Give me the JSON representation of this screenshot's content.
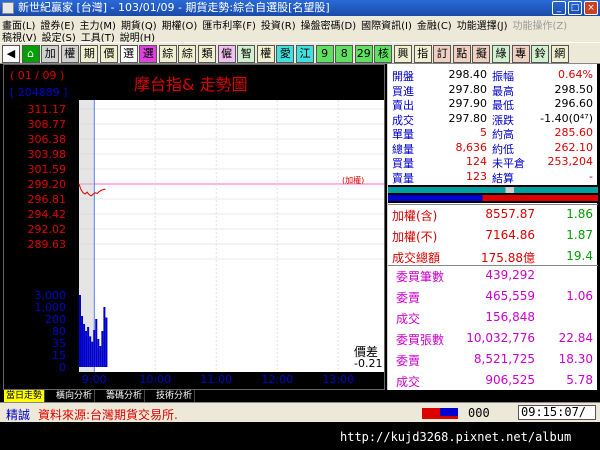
{
  "window": {
    "title": "新世紀贏家 [台灣] - 103/01/09 - 期貨走勢:綜合自選股[名望股]",
    "min_label": "_",
    "max_label": "□",
    "close_label": "×"
  },
  "menu": {
    "row1": [
      {
        "label": "畫面(L)",
        "enabled": true
      },
      {
        "label": "證券(E)",
        "enabled": true
      },
      {
        "label": "主力(M)",
        "enabled": true
      },
      {
        "label": "期貨(Q)",
        "enabled": true
      },
      {
        "label": "期權(O)",
        "enabled": true
      },
      {
        "label": "匯市利率(F)",
        "enabled": true
      },
      {
        "label": "投資(R)",
        "enabled": true
      },
      {
        "label": "操盤密碼(D)",
        "enabled": true
      },
      {
        "label": "國際資訊(I)",
        "enabled": true
      },
      {
        "label": "金融(C)",
        "enabled": true
      },
      {
        "label": "功能選擇(J)",
        "enabled": true
      },
      {
        "label": "功能操作(Z)",
        "enabled": false
      }
    ],
    "row2": [
      {
        "label": "稿視(V)",
        "enabled": true
      },
      {
        "label": "設定(S)",
        "enabled": true
      },
      {
        "label": "工具(T)",
        "enabled": true
      },
      {
        "label": "說明(H)",
        "enabled": true
      }
    ]
  },
  "toolbar": {
    "buttons": [
      {
        "label": "◀",
        "bg": "#ffffff",
        "fg": "#000000"
      },
      {
        "label": "⌂",
        "bg": "#00a000",
        "fg": "#ffffff"
      },
      {
        "label": "加",
        "bg": "#d0d0d0",
        "fg": "#000000"
      },
      {
        "label": "權",
        "bg": "#d0d0d0",
        "fg": "#000000"
      },
      {
        "label": "期",
        "bg": "#f0f0d0",
        "fg": "#000000"
      },
      {
        "label": "價",
        "bg": "#f0f0d0",
        "fg": "#000000"
      },
      {
        "label": "選",
        "bg": "#ffffff",
        "fg": "#000000"
      },
      {
        "label": "選",
        "bg": "#e040e0",
        "fg": "#000000"
      },
      {
        "label": "綜",
        "bg": "#f0f0d0",
        "fg": "#000000"
      },
      {
        "label": "綜",
        "bg": "#f0f0d0",
        "fg": "#000000"
      },
      {
        "label": "類",
        "bg": "#f0f0d0",
        "fg": "#000000"
      },
      {
        "label": "僱",
        "bg": "#f0c0f0",
        "fg": "#000000"
      },
      {
        "label": "智",
        "bg": "#d0f0d0",
        "fg": "#000000"
      },
      {
        "label": "權",
        "bg": "#f0f0d0",
        "fg": "#000000"
      },
      {
        "label": "愛",
        "bg": "#40e0e0",
        "fg": "#000000"
      },
      {
        "label": "江",
        "bg": "#40e0e0",
        "fg": "#000000"
      },
      {
        "label": "9",
        "bg": "#60e060",
        "fg": "#000000"
      },
      {
        "label": "8",
        "bg": "#60e060",
        "fg": "#000000"
      },
      {
        "label": "29",
        "bg": "#60e060",
        "fg": "#000000"
      },
      {
        "label": "核",
        "bg": "#60e060",
        "fg": "#000000"
      },
      {
        "label": "興",
        "bg": "#f0f0d0",
        "fg": "#000000"
      },
      {
        "label": "指",
        "bg": "#f0f0d0",
        "fg": "#000000"
      },
      {
        "label": "訂",
        "bg": "#f0d0c0",
        "fg": "#000000"
      },
      {
        "label": "點",
        "bg": "#f0d0c0",
        "fg": "#000000"
      },
      {
        "label": "擬",
        "bg": "#f0d0c0",
        "fg": "#000000"
      },
      {
        "label": "綠",
        "bg": "#d0f0d0",
        "fg": "#000000"
      },
      {
        "label": "專",
        "bg": "#f0d0c0",
        "fg": "#000000"
      },
      {
        "label": "鈴",
        "bg": "#d0f0d0",
        "fg": "#000000"
      },
      {
        "label": "網",
        "bg": "#f0f0d0",
        "fg": "#000000"
      }
    ]
  },
  "chart": {
    "date": "( 01 / 09 )",
    "title": "摩台指&  走勢圖",
    "volume_box": "[ 204889 ]",
    "ref_label": "(加權)",
    "spread_label": "價差",
    "spread_value": "-0.21",
    "price_ticks": [
      "311.17",
      "308.77",
      "306.38",
      "303.98",
      "301.59",
      "299.20",
      "296.81",
      "294.42",
      "292.02",
      "289.63",
      "287.23"
    ],
    "ref_price_index": 5,
    "volume_ticks": [
      "3,000",
      "1,000",
      "200",
      "80",
      "35",
      "15",
      "0"
    ],
    "time_ticks": [
      "9:00",
      "10:00",
      "11:00",
      "12:00",
      "13:00"
    ]
  },
  "chart_data": {
    "type": "line",
    "title": "摩台指&  走勢圖",
    "x": [
      "08:45",
      "08:47",
      "08:49",
      "08:51",
      "08:53",
      "08:55",
      "08:57",
      "08:59",
      "09:01",
      "09:03",
      "09:05",
      "09:07",
      "09:09",
      "09:11"
    ],
    "series": [
      {
        "values": [
          299.2,
          298.3,
          297.8,
          297.6,
          297.9,
          297.5,
          297.3,
          297.6,
          297.8,
          297.7,
          298.0,
          298.2,
          298.3,
          298.4
        ]
      }
    ],
    "volume": [
      3000,
      400,
      150,
      80,
      120,
      60,
      40,
      90,
      200,
      50,
      30,
      80,
      1000,
      300
    ],
    "ylim": [
      287.23,
      311.17
    ],
    "xlim": [
      "08:45",
      "13:45"
    ]
  },
  "quote": {
    "rows": [
      {
        "l1": "開盤",
        "v1": "298.40",
        "l2": "振幅",
        "v2": "0.64%",
        "c1": "#000000",
        "c2": "#dd0000"
      },
      {
        "l1": "買進",
        "v1": "297.80",
        "l2": "最高",
        "v2": "298.50",
        "c1": "#000000",
        "c2": "#000000"
      },
      {
        "l1": "賣出",
        "v1": "297.90",
        "l2": "最低",
        "v2": "296.60",
        "c1": "#000000",
        "c2": "#000000"
      },
      {
        "l1": "成交",
        "v1": "297.80",
        "l2": "漲跌",
        "v2": "-1.40(0⁴⁷)",
        "c1": "#000000",
        "c2": "#000000"
      },
      {
        "l1": "單量",
        "v1": "5",
        "l2": "約高",
        "v2": "285.60",
        "c1": "#dd0000",
        "c2": "#dd0000"
      },
      {
        "l1": "總量",
        "v1": "8,636",
        "l2": "約低",
        "v2": "262.10",
        "c1": "#dd0000",
        "c2": "#dd0000"
      },
      {
        "l1": "買量",
        "v1": "124",
        "l2": "未平倉",
        "v2": "253,204",
        "c1": "#dd0000",
        "c2": "#dd0000"
      },
      {
        "l1": "賣量",
        "v1": "123",
        "l2": "結算",
        "v2": "-",
        "c1": "#dd0000",
        "c2": "#dd0000"
      }
    ],
    "index_rows": [
      {
        "label": "加權(含)",
        "value": "8557.87",
        "pct": "1.86"
      },
      {
        "label": "加權(不)",
        "value": "7164.86",
        "pct": "1.87"
      },
      {
        "label": "成交總額",
        "value": "175.88億",
        "pct": "19.4"
      }
    ],
    "order_rows": [
      {
        "label": "委買筆數",
        "value": "439,292",
        "pct": ""
      },
      {
        "label": "委賣",
        "value": "465,559",
        "pct": "1.06"
      },
      {
        "label": "成交",
        "value": "156,848",
        "pct": ""
      },
      {
        "label": "委買張數",
        "value": "10,032,776",
        "pct": "22.84"
      },
      {
        "label": "委賣",
        "value": "8,521,725",
        "pct": "18.30"
      },
      {
        "label": "成交",
        "value": "906,525",
        "pct": "5.78"
      }
    ]
  },
  "tabs": [
    {
      "label": "當日走勢",
      "active": true
    },
    {
      "label": "橫向分析",
      "active": false
    },
    {
      "label": "籌碼分析",
      "active": false
    },
    {
      "label": "技術分析",
      "active": false
    }
  ],
  "status": {
    "name": "精誠",
    "source": "資料來源:台灣期貨交易所.",
    "counter": "000",
    "time": "09:15:07/"
  },
  "watermark": "http://kujd3268.pixnet.net/album"
}
